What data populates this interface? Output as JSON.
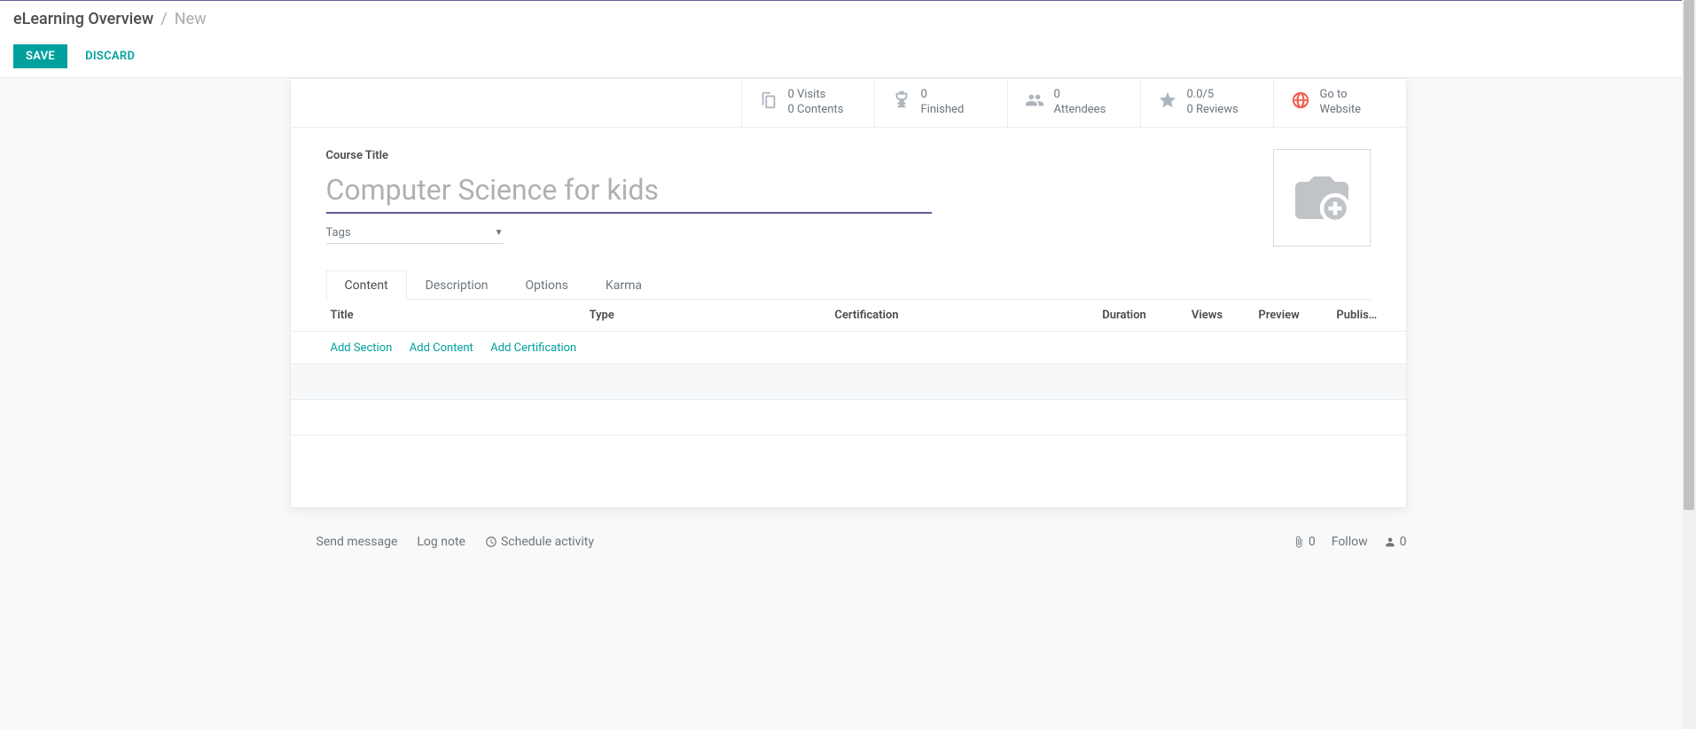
{
  "breadcrumb": {
    "root": "eLearning Overview",
    "sep": "/",
    "current": "New"
  },
  "buttons": {
    "save": "SAVE",
    "discard": "DISCARD"
  },
  "stats": {
    "visits": {
      "line1": "0 Visits",
      "line2": "0 Contents"
    },
    "finished": {
      "line1": "0",
      "line2": "Finished"
    },
    "attendees": {
      "line1": "0",
      "line2": "Attendees"
    },
    "reviews": {
      "line1": "0.0/5",
      "line2": "0 Reviews"
    },
    "website": {
      "line1": "Go to",
      "line2": "Website"
    }
  },
  "form": {
    "title_label": "Course Title",
    "title_placeholder": "Computer Science for kids",
    "title_value": "",
    "tags_placeholder": "Tags"
  },
  "tabs": {
    "content": "Content",
    "description": "Description",
    "options": "Options",
    "karma": "Karma"
  },
  "columns": {
    "title": "Title",
    "type": "Type",
    "certification": "Certification",
    "duration": "Duration",
    "views": "Views",
    "preview": "Preview",
    "published": "Publis…"
  },
  "row_actions": {
    "add_section": "Add Section",
    "add_content": "Add Content",
    "add_certification": "Add Certification"
  },
  "chatter": {
    "send_message": "Send message",
    "log_note": "Log note",
    "schedule_activity": "Schedule activity",
    "attachments": "0",
    "follow": "Follow",
    "followers": "0"
  }
}
